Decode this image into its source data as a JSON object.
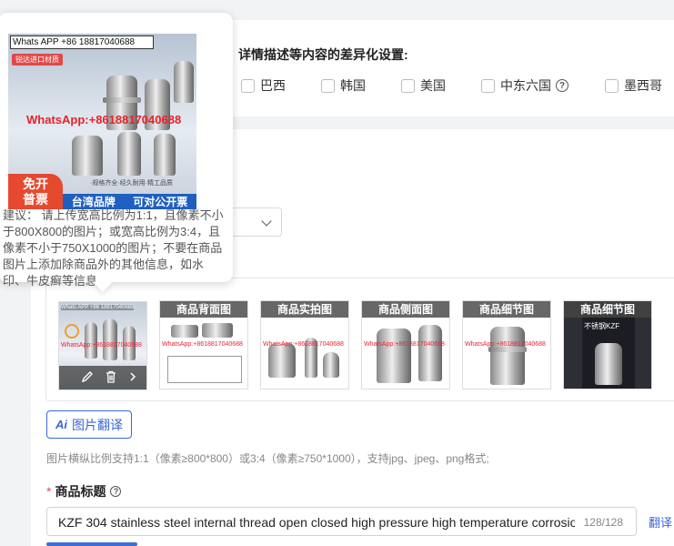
{
  "differentiation": {
    "title": "详情描述等内容的差异化设置:",
    "countries": [
      {
        "label": "巴西",
        "checked": false
      },
      {
        "label": "韩国",
        "checked": false
      },
      {
        "label": "美国",
        "checked": false
      },
      {
        "label": "中东六国",
        "checked": false,
        "help": true
      },
      {
        "label": "墨西哥",
        "checked": false
      }
    ]
  },
  "tooltip": {
    "preview_header": "Whats APP +86 18817040688",
    "preview_tag": "锐达进口材质",
    "preview_watermark": "WhatsApp:+8618817040688",
    "preview_slogan": "·规格齐全·经久耐用·精工品质",
    "preview_badge_left": "免开普票",
    "preview_badge_left_line1": "免开",
    "preview_badge_left_line2": "普票",
    "preview_badge_mid": "台湾品牌",
    "preview_badge_right": "可对公开票",
    "text": "建议： 请上传宽高比例为1:1，且像素不小于800X800的图片；或宽高比例为3:4，且像素不小于750X1000的图片；不要在商品图片上添加除商品外的其他信息，如水印、牛皮癣等信息"
  },
  "images": {
    "main_thumb": {
      "header": "Whats APP +86 18817040688",
      "watermark": "WhatsApp:+8618817040688",
      "actions": [
        "edit-icon",
        "delete-icon",
        "next-icon"
      ]
    },
    "thumbs": [
      {
        "label": "商品背面图",
        "watermark": "WhatsApp:+8618817040688"
      },
      {
        "label": "商品实拍图",
        "watermark": "WhatsApp:+8618817040688"
      },
      {
        "label": "商品侧面图",
        "watermark": "WhatsApp:+8618817040688"
      },
      {
        "label": "商品细节图",
        "watermark": "WhatsApp:+8618817040688"
      },
      {
        "label": "商品细节图",
        "watermark": "不锈钢KZF"
      }
    ]
  },
  "translate_button": {
    "ai": "Ai",
    "label": "图片翻译"
  },
  "image_hint": "图片横纵比例支持1:1（像素≥800*800）或3:4（像素≥750*1000），支持jpg、jpeg、png格式;",
  "product_title": {
    "label": "商品标题",
    "required_mark": "*",
    "value": "KZF 304 stainless steel internal thread open closed high pressure high temperature corrosio",
    "count": "128/128",
    "translate_link": "翻译"
  },
  "colors": {
    "accent": "#3867d6",
    "required": "#e34d59",
    "watermark": "#e8232a"
  }
}
